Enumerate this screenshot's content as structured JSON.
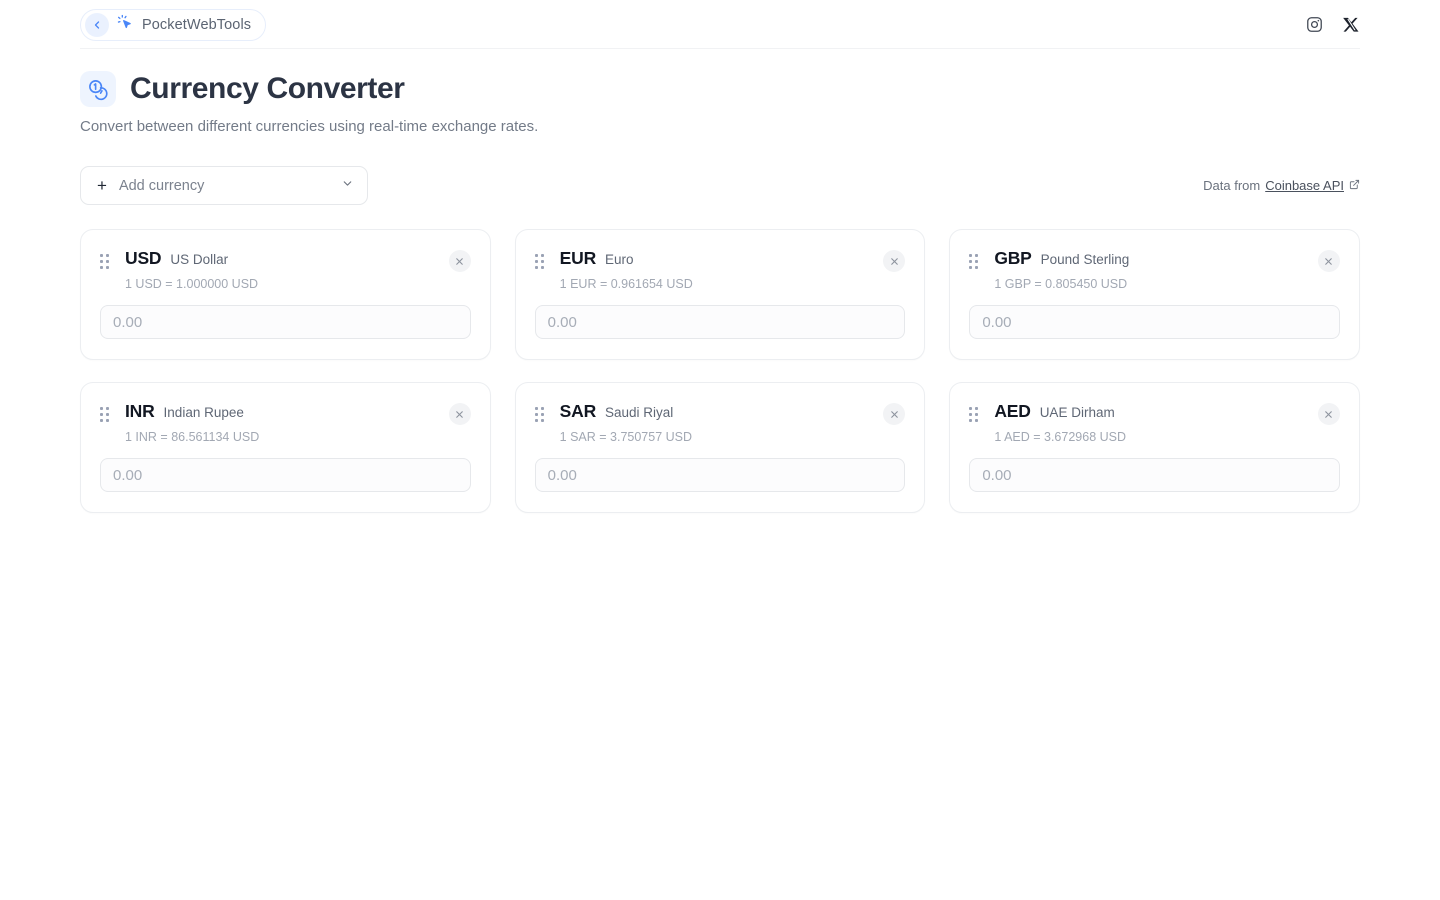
{
  "header": {
    "brand": "PocketWebTools",
    "back_icon": "chevron-left-icon",
    "cursor_icon": "cursor-click-icon",
    "social": [
      {
        "name": "instagram-icon"
      },
      {
        "name": "x-twitter-icon"
      }
    ]
  },
  "page": {
    "icon": "currency-coins-icon",
    "title": "Currency Converter",
    "subtitle": "Convert between different currencies using real-time exchange rates."
  },
  "toolbar": {
    "add_currency_label": "Add currency",
    "add_plus": "+",
    "chevron": "chevron-down-icon",
    "data_from_prefix": "Data from",
    "data_source_label": "Coinbase API"
  },
  "colors": {
    "accent": "#4a86f7",
    "accent_soft": "#eaf1fe",
    "title": "#2c3444",
    "muted": "#a2a8b3",
    "border": "#eceef1"
  },
  "currencies": [
    {
      "code": "USD",
      "name": "US Dollar",
      "rate": "1 USD = 1.000000 USD",
      "placeholder": "0.00",
      "value": ""
    },
    {
      "code": "EUR",
      "name": "Euro",
      "rate": "1 EUR = 0.961654 USD",
      "placeholder": "0.00",
      "value": ""
    },
    {
      "code": "GBP",
      "name": "Pound Sterling",
      "rate": "1 GBP = 0.805450 USD",
      "placeholder": "0.00",
      "value": ""
    },
    {
      "code": "INR",
      "name": "Indian Rupee",
      "rate": "1 INR = 86.561134 USD",
      "placeholder": "0.00",
      "value": ""
    },
    {
      "code": "SAR",
      "name": "Saudi Riyal",
      "rate": "1 SAR = 3.750757 USD",
      "placeholder": "0.00",
      "value": ""
    },
    {
      "code": "AED",
      "name": "UAE Dirham",
      "rate": "1 AED = 3.672968 USD",
      "placeholder": "0.00",
      "value": ""
    }
  ]
}
